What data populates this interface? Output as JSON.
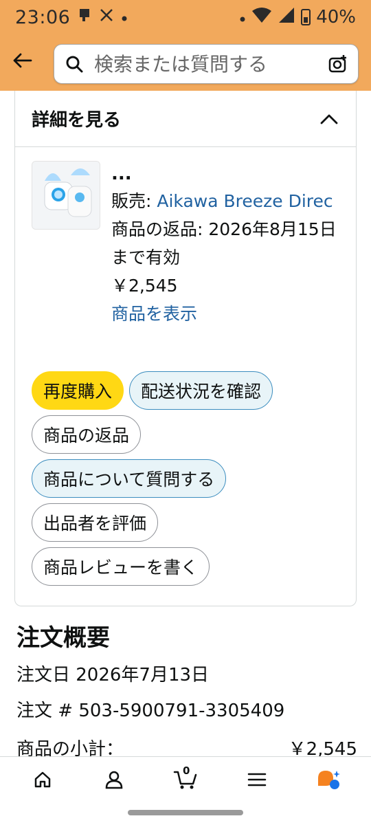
{
  "status_bar": {
    "time": "23:06",
    "battery": "40%"
  },
  "search": {
    "placeholder": "検索または質問する"
  },
  "details": {
    "title": "詳細を見る",
    "item": {
      "ellipsis": "...",
      "seller_label": "販売: ",
      "seller_name": "Aikawa Breeze Direc",
      "return_text": "商品の返品: 2026年8月15日まで有効",
      "price": "￥2,545",
      "view_item": "商品を表示"
    },
    "buttons": {
      "buy_again": "再度購入",
      "track_package": "配送状況を確認",
      "return_item": "商品の返品",
      "ask_question": "商品について質問する",
      "rate_seller": "出品者を評価",
      "write_review": "商品レビューを書く"
    }
  },
  "summary": {
    "title": "注文概要",
    "order_date": "注文日 2026年7月13日",
    "order_number": "注文 # 503-5900791-3305409",
    "subtotal_label_pre": "商品の",
    "subtotal_label_u": "小計",
    "subtotal_label_post": "：",
    "subtotal_value": "￥2,545"
  },
  "bottom_nav": {
    "cart_count": "0"
  },
  "colors": {
    "header_bg": "#f2a95c",
    "buy_again_bg": "#ffd814",
    "link": "#2162a1",
    "accent_border": "#3a8cbe"
  }
}
